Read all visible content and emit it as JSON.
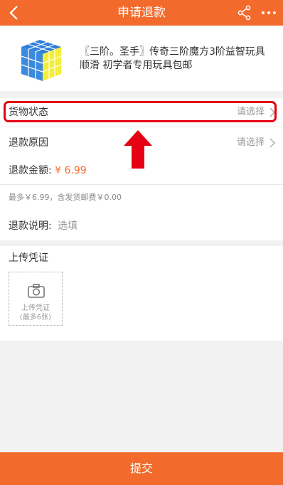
{
  "header": {
    "title": "申请退款",
    "back_icon": "chevron-left-icon",
    "share_icon": "share-icon",
    "more_icon": "more-dots-icon"
  },
  "product": {
    "title": "〖三阶。圣手〗传奇三阶魔方3阶益智玩具顺滑 初学者专用玩具包邮",
    "image_icon": "rubiks-cube-image"
  },
  "form": {
    "goods_status": {
      "label": "货物状态",
      "value": "请选择"
    },
    "refund_reason": {
      "label": "退款原因",
      "value": "请选择"
    },
    "refund_amount": {
      "label": "退款金额:",
      "currency": "¥",
      "amount": "6.99"
    },
    "amount_note": "最多￥6.99，含发货邮费￥0.00",
    "refund_desc": {
      "label": "退款说明:",
      "placeholder": "选填"
    }
  },
  "upload": {
    "title": "上传凭证",
    "box_line1": "上传凭证",
    "box_line2": "(最多6张)"
  },
  "submit_label": "提交",
  "colors": {
    "accent": "#f26b2c",
    "highlight": "#e50012",
    "background": "#f2f2f2"
  }
}
